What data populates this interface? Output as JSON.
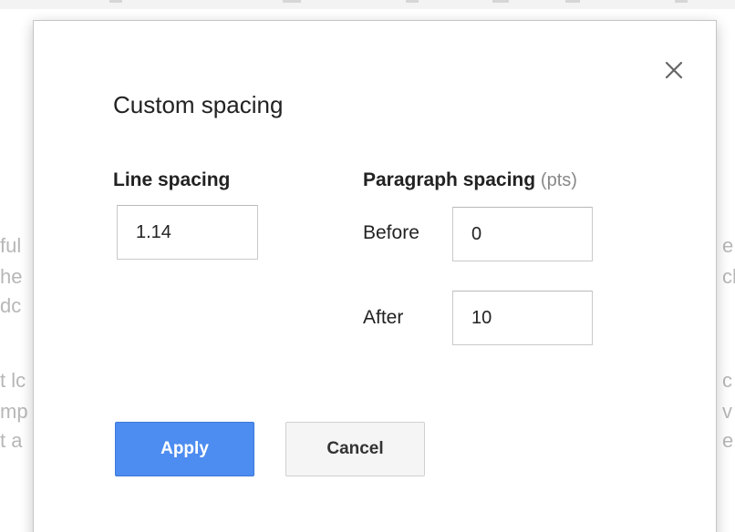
{
  "background": {
    "left_fragments": [
      "ful",
      "he",
      "dc",
      "",
      "t lc",
      "mp",
      "t a"
    ],
    "right_fragments": [
      "e",
      "cl",
      "",
      "",
      "c",
      "v",
      "e"
    ]
  },
  "dialog": {
    "title": "Custom spacing",
    "close_icon": "close-icon",
    "line_spacing": {
      "label": "Line spacing",
      "value": "1.14"
    },
    "paragraph_spacing": {
      "label": "Paragraph spacing",
      "unit": "(pts)",
      "before_label": "Before",
      "before_value": "0",
      "after_label": "After",
      "after_value": "10"
    },
    "apply_label": "Apply",
    "cancel_label": "Cancel"
  },
  "colors": {
    "apply_button": "#4d8cf0",
    "cancel_button": "#f5f5f5",
    "unit_text": "#888888"
  }
}
